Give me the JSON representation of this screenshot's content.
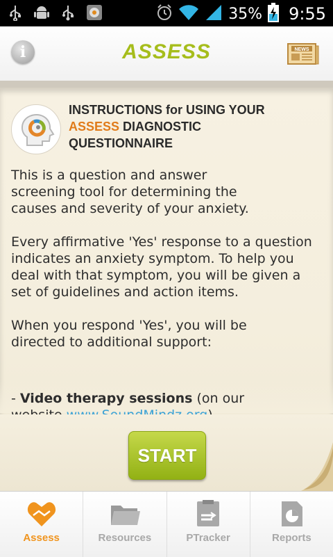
{
  "status_bar": {
    "battery_percent": "35%",
    "time": "9:55",
    "icons": [
      "usb-icon",
      "android-debug-icon",
      "usb-icon",
      "app-notification-icon",
      "alarm-icon",
      "wifi-icon",
      "signal-icon",
      "battery-charging-icon"
    ]
  },
  "header": {
    "title": "ASSESS",
    "info_icon": "info-icon",
    "news_icon": "news-icon",
    "news_label": "NEWS"
  },
  "instructions": {
    "heading_part1": "INSTRUCTIONS for USING YOUR",
    "heading_accent": "ASSESS",
    "heading_part2": " DIAGNOSTIC QUESTIONNAIRE",
    "paragraph1": "This is a question and answer screening tool for determining the causes and severity of your anxiety.",
    "paragraph2": "Every affirmative 'Yes' response to a question indicates an anxiety symptom. To help you deal with that symptom, you will be given a set of guidelines and action items.",
    "paragraph3": "When you respond 'Yes', you will be directed to additional support:",
    "bullet_prefix": "- ",
    "bullet_bold": "Video therapy sessions",
    "bullet_rest": " (on our",
    "bullet_line2": "website ",
    "bullet_link": "www.SoundMindz.org",
    "bullet_line2_end": ")"
  },
  "start_button": "START",
  "tabs": [
    {
      "label": "Assess",
      "icon": "heart-hands-icon",
      "active": true
    },
    {
      "label": "Resources",
      "icon": "folder-icon",
      "active": false
    },
    {
      "label": "PTracker",
      "icon": "tracker-icon",
      "active": false
    },
    {
      "label": "Reports",
      "icon": "report-icon",
      "active": false
    }
  ],
  "colors": {
    "title_green": "#a6bd1c",
    "accent_orange": "#e07b1a",
    "active_tab": "#f0941e",
    "start_green": "#92b114",
    "link_blue": "#3aa2d6"
  }
}
